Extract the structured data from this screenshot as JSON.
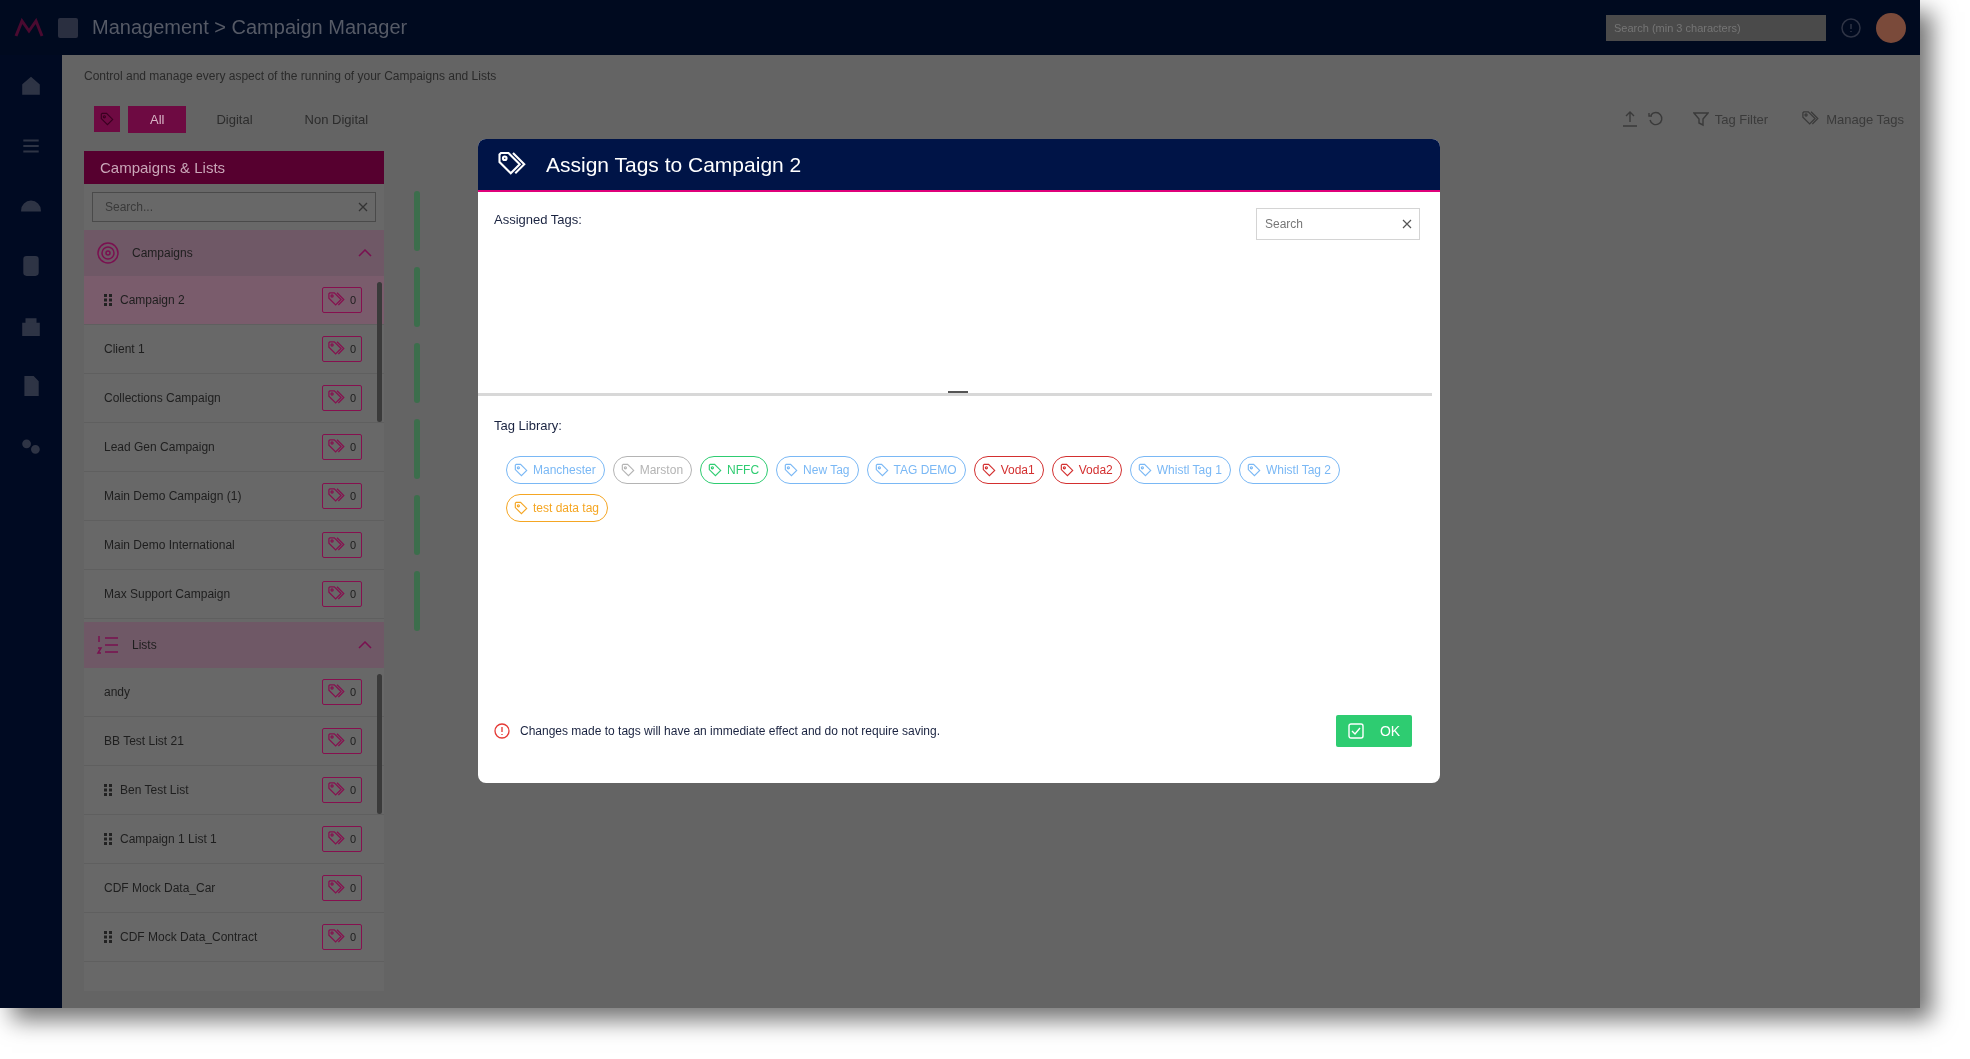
{
  "top_bar": {
    "title": "Management > Campaign Manager",
    "search": {
      "placeholder": "Search (min 3 characters)"
    }
  },
  "page": {
    "description": "Control and manage every aspect of the running of your Campaigns and Lists"
  },
  "filter_tabs": [
    {
      "label": "All",
      "selected": true
    },
    {
      "label": "Digital",
      "selected": false
    },
    {
      "label": "Non Digital",
      "selected": false
    }
  ],
  "toolbar_actions": [
    {
      "kind": "filter",
      "label": "Tag Filter"
    },
    {
      "kind": "tags",
      "label": "Manage Tags"
    }
  ],
  "sidebar": {
    "title": "Campaigns & Lists",
    "search": {
      "placeholder": "Search..."
    },
    "sections": [
      {
        "kind": "campaigns",
        "title": "Campaigns",
        "expanded": true,
        "items": [
          {
            "name": "Campaign 2",
            "draggable": true,
            "selected": true,
            "tag_count": "0"
          },
          {
            "name": "Client 1",
            "draggable": false,
            "selected": false,
            "tag_count": "0"
          },
          {
            "name": "Collections Campaign",
            "draggable": false,
            "selected": false,
            "tag_count": "0"
          },
          {
            "name": "Lead Gen Campaign",
            "draggable": false,
            "selected": false,
            "tag_count": "0"
          },
          {
            "name": "Main Demo Campaign (1)",
            "draggable": false,
            "selected": false,
            "tag_count": "0"
          },
          {
            "name": "Main Demo International",
            "draggable": false,
            "selected": false,
            "tag_count": "0"
          },
          {
            "name": "Max Support Campaign",
            "draggable": false,
            "selected": false,
            "tag_count": "0"
          }
        ]
      },
      {
        "kind": "lists",
        "title": "Lists",
        "expanded": true,
        "items": [
          {
            "name": "andy",
            "draggable": false,
            "selected": false,
            "tag_count": "0"
          },
          {
            "name": "BB Test List 21",
            "draggable": false,
            "selected": false,
            "tag_count": "0"
          },
          {
            "name": "Ben Test List",
            "draggable": true,
            "selected": false,
            "tag_count": "0"
          },
          {
            "name": "Campaign 1 List 1",
            "draggable": true,
            "selected": false,
            "tag_count": "0"
          },
          {
            "name": "CDF Mock Data_Car",
            "draggable": false,
            "selected": false,
            "tag_count": "0"
          },
          {
            "name": "CDF Mock Data_Contract",
            "draggable": true,
            "selected": false,
            "tag_count": "0"
          }
        ]
      }
    ]
  },
  "dialog": {
    "title": "Assign Tags to Campaign 2",
    "assigned_label": "Assigned Tags:",
    "search": {
      "placeholder": "Search"
    },
    "library_label": "Tag Library:",
    "tags": [
      {
        "label": "Manchester",
        "color": "#7ab8f5"
      },
      {
        "label": "Marston",
        "color": "#b4b4b4"
      },
      {
        "label": "NFFC",
        "color": "#2ecc71"
      },
      {
        "label": "New Tag",
        "color": "#7ab8f5"
      },
      {
        "label": "TAG DEMO",
        "color": "#7ab8f5"
      },
      {
        "label": "Voda1",
        "color": "#d32f2f"
      },
      {
        "label": "Voda2",
        "color": "#d32f2f"
      },
      {
        "label": "Whistl Tag 1",
        "color": "#7ab8f5"
      },
      {
        "label": "Whistl Tag 2",
        "color": "#7ab8f5"
      },
      {
        "label": "test data tag",
        "color": "#f5a623"
      }
    ],
    "notice": "Changes made to tags will have an immediate effect and do not require saving.",
    "ok_button": "OK"
  }
}
